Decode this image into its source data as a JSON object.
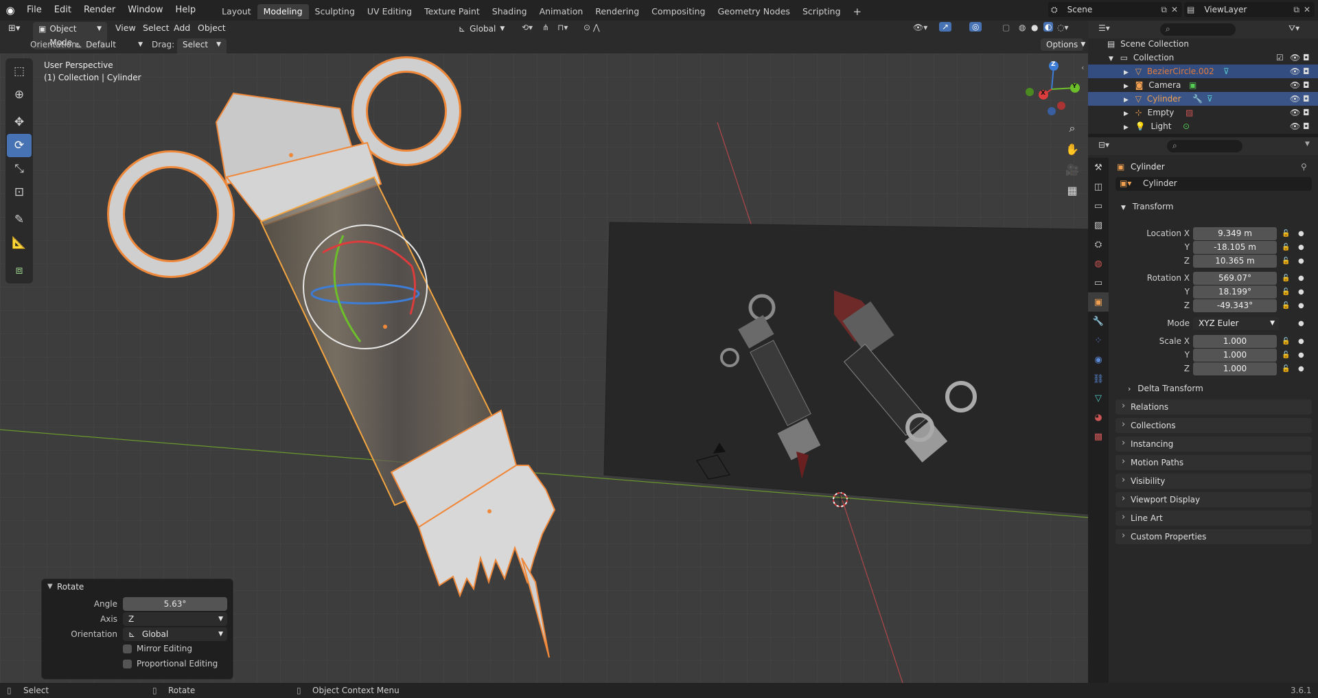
{
  "menus": [
    "File",
    "Edit",
    "Render",
    "Window",
    "Help"
  ],
  "workspaces": [
    "Layout",
    "Modeling",
    "Sculpting",
    "UV Editing",
    "Texture Paint",
    "Shading",
    "Animation",
    "Rendering",
    "Compositing",
    "Geometry Nodes",
    "Scripting"
  ],
  "active_workspace": "Modeling",
  "add_workspace": "+",
  "scene": "Scene",
  "view_layer": "ViewLayer",
  "header": {
    "mode": "Object Mode",
    "view": "View",
    "select": "Select",
    "add": "Add",
    "object": "Object",
    "transform_orientation": "Global",
    "orientation_label": "Orientation:",
    "orientation_value": "Default",
    "drag_label": "Drag:",
    "drag_value": "Select Box",
    "options": "Options"
  },
  "viewport": {
    "perspective": "User Perspective",
    "collection_info": "(1) Collection | Cylinder",
    "gizmo_axes": [
      "Z",
      "Y",
      "X"
    ]
  },
  "redo_panel": {
    "title": "Rotate",
    "angle_label": "Angle",
    "angle_value": "5.63°",
    "axis_label": "Axis",
    "axis_value": "Z",
    "orientation_label": "Orientation",
    "orientation_value": "Global",
    "mirror_label": "Mirror Editing",
    "proportional_label": "Proportional Editing"
  },
  "outliner": {
    "scene_collection": "Scene Collection",
    "collection": "Collection",
    "items": [
      {
        "name": "BezierCircle.002",
        "color": "#e07a3c"
      },
      {
        "name": "Camera",
        "color": "#dddddd"
      },
      {
        "name": "Cylinder",
        "color": "#f0a050"
      },
      {
        "name": "Empty",
        "color": "#dddddd"
      },
      {
        "name": "Light",
        "color": "#dddddd"
      }
    ]
  },
  "properties": {
    "object_name": "Cylinder",
    "datablock": "Cylinder",
    "transform_title": "Transform",
    "location_label": "Location X",
    "location": [
      "9.349 m",
      "-18.105 m",
      "10.365 m"
    ],
    "rotation_label": "Rotation X",
    "rotation": [
      "569.07°",
      "18.199°",
      "-49.343°"
    ],
    "axis_y": "Y",
    "axis_z": "Z",
    "mode_label": "Mode",
    "mode_value": "XYZ Euler",
    "scale_label": "Scale X",
    "scale": [
      "1.000",
      "1.000",
      "1.000"
    ],
    "delta_transform": "Delta Transform",
    "panels": [
      "Relations",
      "Collections",
      "Instancing",
      "Motion Paths",
      "Visibility",
      "Viewport Display",
      "Line Art",
      "Custom Properties"
    ]
  },
  "status": {
    "select": "Select",
    "rotate": "Rotate",
    "context": "Object Context Menu",
    "version": "3.6.1"
  },
  "colors": {
    "accent": "#4772b3",
    "selection": "#f39c3c",
    "header_bg": "#232323",
    "viewport_bg": "#3d3d3d"
  }
}
